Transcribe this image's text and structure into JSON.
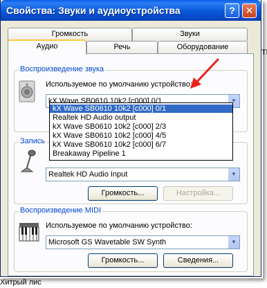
{
  "window": {
    "title": "Свойства: Звуки и аудиоустройства",
    "help_button": "?",
    "close_button": "✕"
  },
  "tabs": {
    "row1": [
      "Громкость",
      "Звуки"
    ],
    "row2": [
      "Аудио",
      "Речь",
      "Оборудование"
    ],
    "active": "Аудио"
  },
  "playback": {
    "title": "Воспроизведение звука",
    "label": "Используемое по умолчанию устройство:",
    "selected": "kX Wave SB0610 10k2 [c000] 0/1",
    "dropdown_items": [
      "kX Wave SB0610 10k2 [c000] 0/1",
      "Realtek HD Audio output",
      "kX Wave SB0610 10k2 [c000] 2/3",
      "kX Wave SB0610 10k2 [c000] 4/5",
      "kX Wave SB0610 10k2 [c000] 6/7",
      "Breakaway Pipeline 1"
    ]
  },
  "recording": {
    "title": "Запись",
    "selected": "Realtek HD Audio Input",
    "volume_button": "Громкость...",
    "settings_button": "Настройка..."
  },
  "midi": {
    "title": "Воспроизведение MIDI",
    "label": "Используемое по умолчанию устройство:",
    "selected": "Microsoft GS Wavetable SW Synth",
    "volume_button": "Громкость...",
    "details_button": "Сведения..."
  },
  "clipped": {
    "right_text": "Th",
    "bottom_text": "Хитрый лис"
  },
  "colors": {
    "titlebar": "#0957da",
    "group_title": "#0046d5",
    "selection": "#316ac5",
    "annotation_arrow": "#e8201a"
  }
}
